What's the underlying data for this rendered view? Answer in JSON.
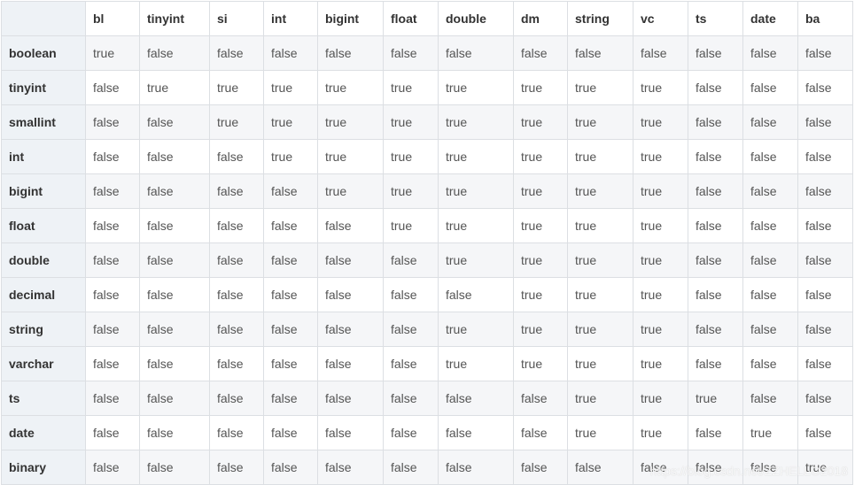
{
  "table": {
    "corner": "",
    "columns": [
      "bl",
      "tinyint",
      "si",
      "int",
      "bigint",
      "float",
      "double",
      "dm",
      "string",
      "vc",
      "ts",
      "date",
      "ba"
    ],
    "rows": [
      {
        "label": "boolean",
        "cells": [
          "true",
          "false",
          "false",
          "false",
          "false",
          "false",
          "false",
          "false",
          "false",
          "false",
          "false",
          "false",
          "false"
        ]
      },
      {
        "label": "tinyint",
        "cells": [
          "false",
          "true",
          "true",
          "true",
          "true",
          "true",
          "true",
          "true",
          "true",
          "true",
          "false",
          "false",
          "false"
        ]
      },
      {
        "label": "smallint",
        "cells": [
          "false",
          "false",
          "true",
          "true",
          "true",
          "true",
          "true",
          "true",
          "true",
          "true",
          "false",
          "false",
          "false"
        ]
      },
      {
        "label": "int",
        "cells": [
          "false",
          "false",
          "false",
          "true",
          "true",
          "true",
          "true",
          "true",
          "true",
          "true",
          "false",
          "false",
          "false"
        ]
      },
      {
        "label": "bigint",
        "cells": [
          "false",
          "false",
          "false",
          "false",
          "true",
          "true",
          "true",
          "true",
          "true",
          "true",
          "false",
          "false",
          "false"
        ]
      },
      {
        "label": "float",
        "cells": [
          "false",
          "false",
          "false",
          "false",
          "false",
          "true",
          "true",
          "true",
          "true",
          "true",
          "false",
          "false",
          "false"
        ]
      },
      {
        "label": "double",
        "cells": [
          "false",
          "false",
          "false",
          "false",
          "false",
          "false",
          "true",
          "true",
          "true",
          "true",
          "false",
          "false",
          "false"
        ]
      },
      {
        "label": "decimal",
        "cells": [
          "false",
          "false",
          "false",
          "false",
          "false",
          "false",
          "false",
          "true",
          "true",
          "true",
          "false",
          "false",
          "false"
        ]
      },
      {
        "label": "string",
        "cells": [
          "false",
          "false",
          "false",
          "false",
          "false",
          "false",
          "true",
          "true",
          "true",
          "true",
          "false",
          "false",
          "false"
        ]
      },
      {
        "label": "varchar",
        "cells": [
          "false",
          "false",
          "false",
          "false",
          "false",
          "false",
          "true",
          "true",
          "true",
          "true",
          "false",
          "false",
          "false"
        ]
      },
      {
        "label": "ts",
        "cells": [
          "false",
          "false",
          "false",
          "false",
          "false",
          "false",
          "false",
          "false",
          "true",
          "true",
          "true",
          "false",
          "false"
        ]
      },
      {
        "label": "date",
        "cells": [
          "false",
          "false",
          "false",
          "false",
          "false",
          "false",
          "false",
          "false",
          "true",
          "true",
          "false",
          "true",
          "false"
        ]
      },
      {
        "label": "binary",
        "cells": [
          "false",
          "false",
          "false",
          "false",
          "false",
          "false",
          "false",
          "false",
          "false",
          "false",
          "false",
          "false",
          "true"
        ]
      }
    ]
  },
  "watermark": "https://blog.csdn.net/ZZHELLO2018",
  "colors": {
    "header_bg": "#eef2f6",
    "stripe_bg": "#f5f6f8",
    "border": "#dcdfe3",
    "text": "#333333"
  }
}
